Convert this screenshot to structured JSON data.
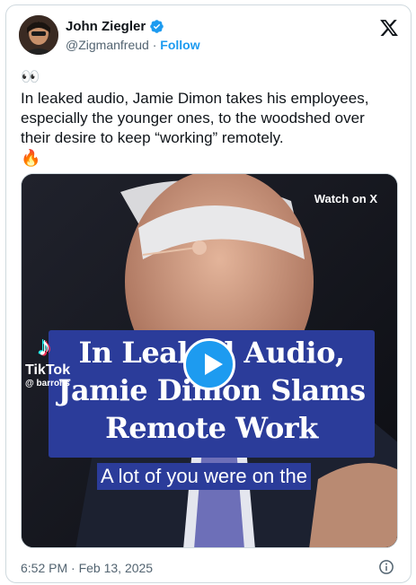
{
  "author": {
    "name": "John Ziegler",
    "handle": "@Zigmanfreud",
    "separator": "·",
    "follow_label": "Follow",
    "verified_color": "#1d9bf0"
  },
  "tweet": {
    "emoji_top": "👀",
    "text": "In leaked audio, Jamie Dimon takes his employees, especially the younger ones, to the woodshed over their desire to keep “working” remotely.",
    "emoji_bottom": "🔥",
    "timestamp": "6:52 PM · Feb 13, 2025"
  },
  "media": {
    "watch_label": "Watch on X",
    "tiktok_glyph": "♪",
    "tiktok_label": "TikTok",
    "tiktok_user": "@ barrons",
    "headline_lines": [
      "In Leaked Audio,",
      "Jamie Dimon Slams",
      "Remote Work"
    ],
    "caption": "A lot of you were on the",
    "headline_bg": "#2b3c9a",
    "play_color": "#1d9bf0"
  },
  "icons": {
    "platform_logo": "x-logo-icon",
    "info": "info-icon",
    "verified": "verified-badge-icon",
    "play": "play-icon"
  }
}
